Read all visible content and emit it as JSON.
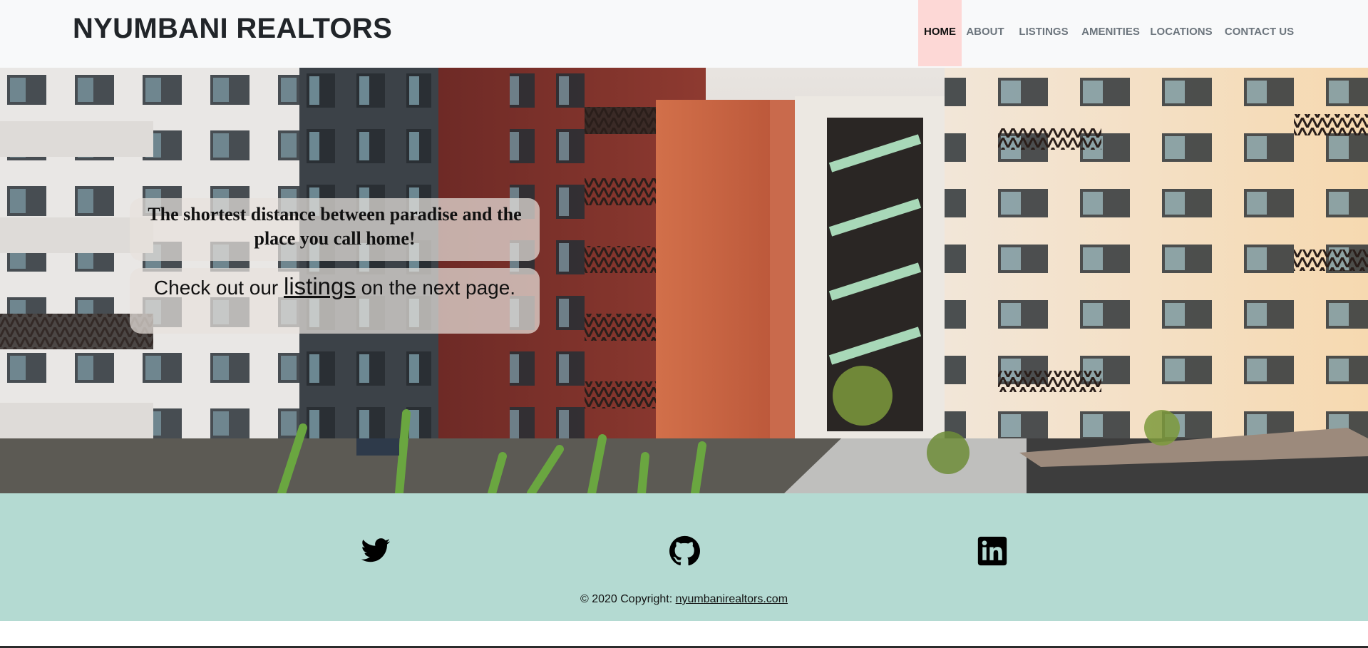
{
  "header": {
    "brand": "NYUMBANI REALTORS",
    "nav": [
      {
        "label": "HOME",
        "active": true
      },
      {
        "label": "ABOUT"
      },
      {
        "label": "LISTINGS"
      },
      {
        "label": "AMENITIES"
      },
      {
        "label": "LOCATIONS"
      },
      {
        "label": "CONTACT US"
      }
    ]
  },
  "hero": {
    "tagline": "The shortest distance between paradise and the place you call home!",
    "cta_prefix": "Check out our",
    "cta_link": "listings",
    "cta_suffix": "on the next page."
  },
  "footer": {
    "social": [
      {
        "icon": "twitter-icon"
      },
      {
        "icon": "github-icon"
      },
      {
        "icon": "linkedin-icon"
      }
    ],
    "copyright_prefix": "© 2020 Copyright:",
    "copyright_link": "nyumbanirealtors.com"
  },
  "colors": {
    "header_bg": "#f8f9fa",
    "active_nav_bg": "#fdd8d6",
    "footer_bg": "#b4dad2"
  }
}
